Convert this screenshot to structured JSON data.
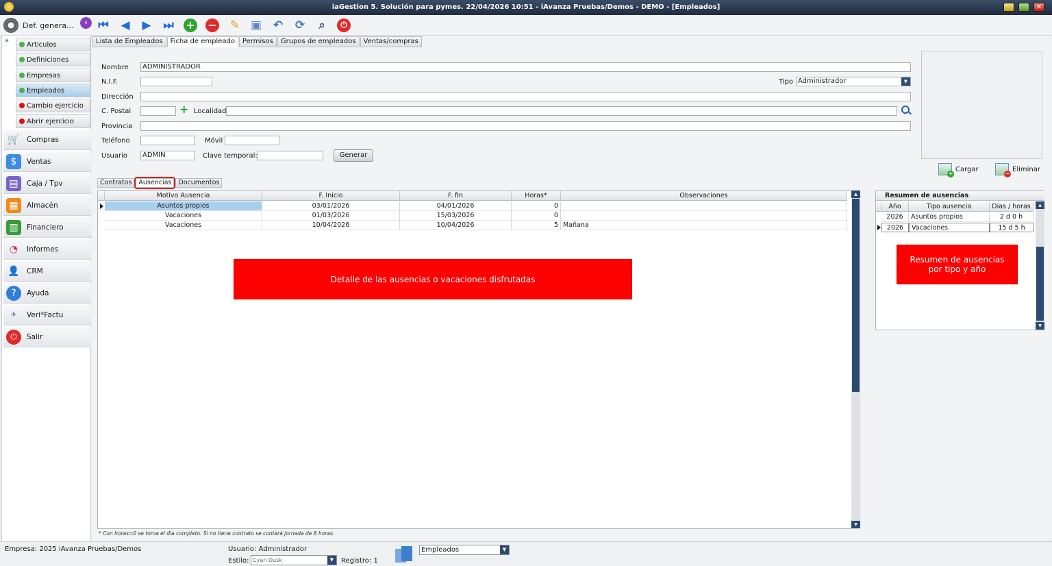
{
  "window": {
    "title": "iaGestion 5. Solución para pymes.   22/04/2026 10:51   -  iAvanza Pruebas/Demos - DEMO - [Empleados]"
  },
  "toolbar": {
    "def_label": "Def. genera..."
  },
  "sidebar": {
    "sub_items": [
      {
        "label": "Articulos",
        "status": "green"
      },
      {
        "label": "Definiciones",
        "status": "green"
      },
      {
        "label": "Empresas",
        "status": "green"
      },
      {
        "label": "Empleados",
        "status": "green"
      },
      {
        "label": "Cambio ejercicio",
        "status": "red"
      },
      {
        "label": "Abrir ejercicio",
        "status": "red"
      }
    ],
    "main_items": [
      {
        "label": "Compras",
        "icon": "cart-icon"
      },
      {
        "label": "Ventas",
        "icon": "ventas-icon"
      },
      {
        "label": "Caja / Tpv",
        "icon": "cash-register-icon"
      },
      {
        "label": "Almacén",
        "icon": "warehouse-icon"
      },
      {
        "label": "Financiero",
        "icon": "finance-icon"
      },
      {
        "label": "Informes",
        "icon": "reports-icon"
      },
      {
        "label": "CRM",
        "icon": "crm-icon"
      },
      {
        "label": "Ayuda",
        "icon": "help-icon"
      },
      {
        "label": "Veri*Factu",
        "icon": "verifactu-icon"
      },
      {
        "label": "Salir",
        "icon": "power-icon"
      }
    ]
  },
  "tabs": [
    "Lista de Empleados",
    "Ficha de empleado",
    "Permisos",
    "Grupos de empleados",
    "Ventas/compras"
  ],
  "form": {
    "nombre_label": "Nombre",
    "nombre_value": "ADMINISTRADOR",
    "nif_label": "N.I.F.",
    "nif_value": "",
    "tipo_label": "Tipo",
    "tipo_value": "Administrador",
    "direccion_label": "Dirección",
    "direccion_value": "",
    "cpostal_label": "C. Postal",
    "cpostal_value": "",
    "localidad_label": "Localidad",
    "localidad_value": "",
    "provincia_label": "Provincia",
    "provincia_value": "",
    "telefono_label": "Teléfono",
    "telefono_value": "",
    "movil_label": "Móvil",
    "movil_value": "",
    "usuario_label": "Usuario",
    "usuario_value": "ADMIN",
    "clave_label": "Clave temporal:",
    "clave_value": "",
    "generar_label": "Generar"
  },
  "photo": {
    "cargar_label": "Cargar",
    "eliminar_label": "Eliminar"
  },
  "sub_tabs": [
    "Contratos",
    "Ausencias",
    "Documentos"
  ],
  "absences": {
    "columns": [
      "Motivo Ausencia",
      "F. Inicio",
      "F. fin",
      "Horas*",
      "Observaciones"
    ],
    "rows": [
      {
        "motivo": "Asuntos propios",
        "inicio": "03/01/2026",
        "fin": "04/01/2026",
        "horas": "0",
        "obs": ""
      },
      {
        "motivo": "Vacaciones",
        "inicio": "01/03/2026",
        "fin": "15/03/2026",
        "horas": "0",
        "obs": ""
      },
      {
        "motivo": "Vacaciones",
        "inicio": "10/04/2026",
        "fin": "10/04/2026",
        "horas": "5",
        "obs": "Mañana"
      }
    ],
    "callout": "Detalle de las ausencias o vacaciones disfrutadas",
    "footnote": "* Con horas=0 se toma el día completo. Si no tiene contrato se contará jornada de 8 horas."
  },
  "summary": {
    "title": "Resumen de ausencias",
    "columns": [
      "Año",
      "Tipo ausencia",
      "Días / horas"
    ],
    "rows": [
      {
        "anio": "2026",
        "tipo": "Asuntos propios",
        "dias": "2 d 0 h"
      },
      {
        "anio": "2026",
        "tipo": "Vacaciones",
        "dias": "15 d 5 h"
      }
    ],
    "callout": "Resumen de ausencias por tipo y año"
  },
  "status": {
    "empresa": "Empresa:  2025    iAvanza Pruebas/Demos",
    "usuario": "Usuario: Administrador",
    "estilo_label": "Estilo:",
    "estilo_value": "Cyan Dusk",
    "registro": "Registro:  1",
    "modulo_value": "Empleados"
  },
  "colors": {
    "accent_navy": "#2d4a70",
    "callout_red": "#fd0000",
    "selected_row": "#a9cfee"
  }
}
